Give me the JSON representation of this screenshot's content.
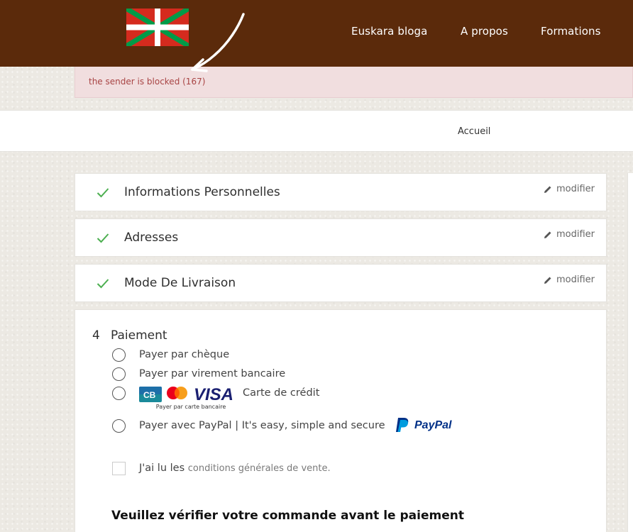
{
  "header": {
    "nav": [
      "Euskara bloga",
      "A propos",
      "Formations"
    ]
  },
  "alert": {
    "message": "the sender is blocked (167)"
  },
  "breadcrumb": {
    "home": "Accueil"
  },
  "steps": [
    {
      "title": "Informations Personnelles",
      "edit": "modifier",
      "complete": true
    },
    {
      "title": "Adresses",
      "edit": "modifier",
      "complete": true
    },
    {
      "title": "Mode De Livraison",
      "edit": "modifier",
      "complete": true
    }
  ],
  "payment": {
    "number": "4",
    "title": "Paiement",
    "options": [
      "Payer par chèque",
      "Payer par virement bancaire",
      "Carte de crédit",
      "Payer avec PayPal | It's easy, simple and secure"
    ],
    "card_logos_caption": "Payer par carte bancaire",
    "paypal_logo": "PayPal",
    "terms_prefix": "J'ai lu les",
    "terms_link": "conditions générales de vente.",
    "verify_heading": "Veuillez vérifier votre commande avant le paiement"
  },
  "colors": {
    "header_bg": "#5b2a0b",
    "alert_bg": "#f1dedf",
    "alert_text": "#a84444",
    "check_green": "#4caf50"
  },
  "icons": {
    "flag": "basque-flag-icon",
    "check": "check-icon",
    "edit": "pencil-icon",
    "annotation": "hand-drawn-arrow-icon"
  }
}
